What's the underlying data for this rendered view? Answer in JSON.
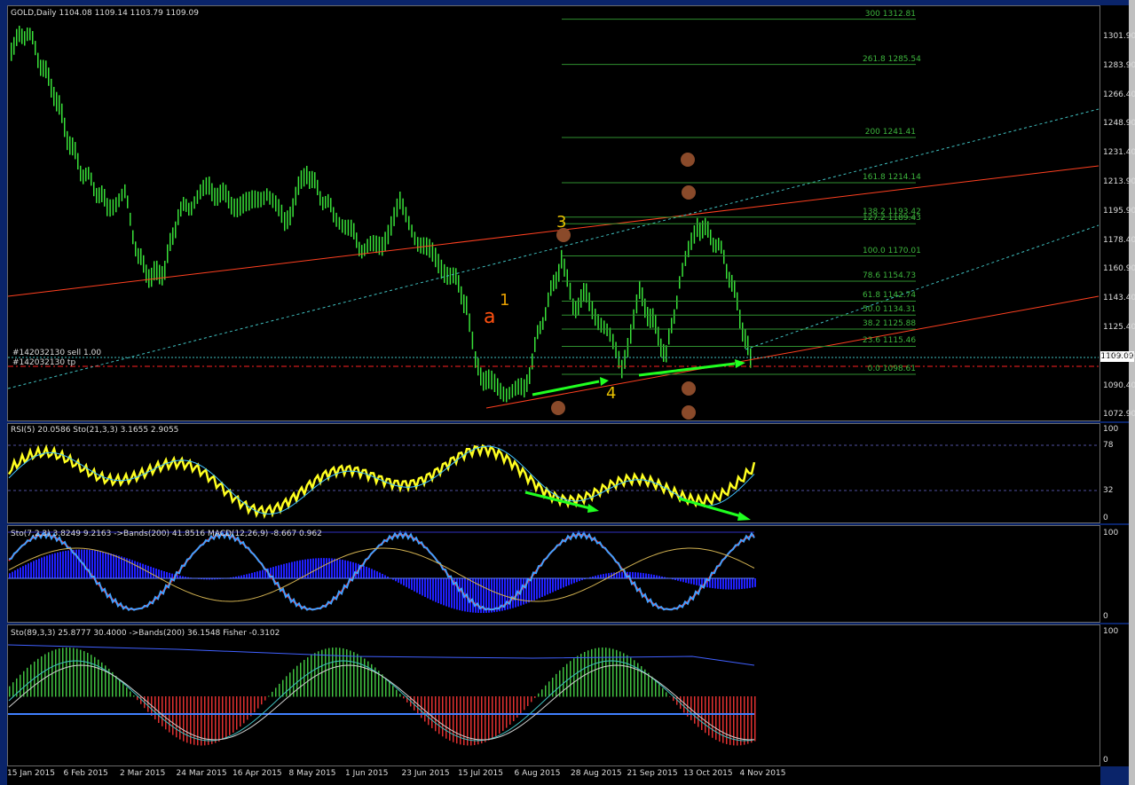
{
  "colors": {
    "bg": "#000000",
    "candle": "#38e038",
    "red_line": "#ff4020",
    "fib": "#3db53d",
    "rsi": "#ffff20",
    "wave": "#e8a000",
    "arrow": "#20ff20",
    "blue": "#2020ff"
  },
  "main": {
    "header": "GOLD,Daily  1104.08 1109.14 1103.79 1109.09",
    "price_ticks": [
      "1301.90",
      "1283.90",
      "1266.40",
      "1248.90",
      "1231.40",
      "1213.90",
      "1195.90",
      "1178.40",
      "1160.90",
      "1143.40",
      "1125.40",
      "1107.90",
      "1090.40",
      "1072.90"
    ],
    "current_price": "1109.09",
    "order_sell": "#142032130 sell 1.00",
    "order_tp": "#142032130 tp",
    "fib_levels": [
      {
        "pct": "300",
        "price": "1312.81"
      },
      {
        "pct": "261.8",
        "price": "1285.54"
      },
      {
        "pct": "200",
        "price": "1241.41"
      },
      {
        "pct": "161.8",
        "price": "1214.14"
      },
      {
        "pct": "138.2",
        "price": "1193.42"
      },
      {
        "pct": "127.2",
        "price": "1189.43"
      },
      {
        "pct": "100.0",
        "price": "1170.01"
      },
      {
        "pct": "78.6",
        "price": "1154.73"
      },
      {
        "pct": "61.8",
        "price": "1142.74"
      },
      {
        "pct": "50.0",
        "price": "1134.31"
      },
      {
        "pct": "38.2",
        "price": "1125.88"
      },
      {
        "pct": "23.6",
        "price": "1115.46"
      },
      {
        "pct": "0.0",
        "price": "1098.61"
      }
    ],
    "wave_labels": {
      "a": "a",
      "one": "1",
      "three": "3",
      "four": "4"
    }
  },
  "rsi_pane": {
    "header": "RSI(5) 20.0586  Sto(21,3,3) 3.1655 2.9055",
    "ticks": [
      "100",
      "78",
      "32",
      "0"
    ]
  },
  "macd_pane": {
    "header": "Sto(7,2,3) 3.8249 9.2163  ->Bands(200) 41.8516  MACD(12,26,9) -8.667 0.962",
    "ticks": [
      "100",
      "0"
    ]
  },
  "fisher_pane": {
    "header": "Sto(89,3,3) 25.8777 30.4000  ->Bands(200) 36.1548  Fisher -0.3102",
    "ticks": [
      "100",
      "0"
    ]
  },
  "dates": [
    "15 Jan 2015",
    "6 Feb 2015",
    "2 Mar 2015",
    "24 Mar 2015",
    "16 Apr 2015",
    "8 May 2015",
    "1 Jun 2015",
    "23 Jun 2015",
    "15 Jul 2015",
    "6 Aug 2015",
    "28 Aug 2015",
    "21 Sep 2015",
    "13 Oct 2015",
    "4 Nov 2015"
  ]
}
